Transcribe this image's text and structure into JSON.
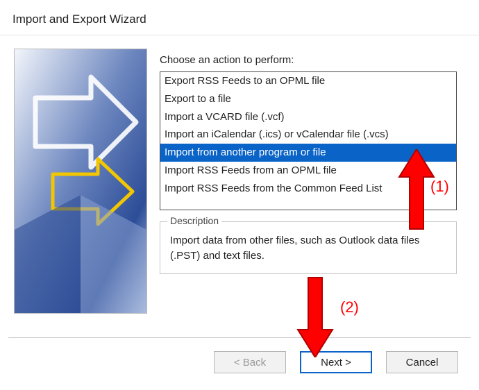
{
  "title": "Import and Export Wizard",
  "prompt": "Choose an action to perform:",
  "actions": [
    "Export RSS Feeds to an OPML file",
    "Export to a file",
    "Import a VCARD file (.vcf)",
    "Import an iCalendar (.ics) or vCalendar file (.vcs)",
    "Import from another program or file",
    "Import RSS Feeds from an OPML file",
    "Import RSS Feeds from the Common Feed List"
  ],
  "selected_index": 4,
  "description": {
    "legend": "Description",
    "text": "Import data from other files, such as Outlook data files (.PST) and text files."
  },
  "buttons": {
    "back": "< Back",
    "next": "Next >",
    "cancel": "Cancel"
  },
  "annotations": {
    "label1": "(1)",
    "label2": "(2)",
    "color": "#ff0000"
  }
}
